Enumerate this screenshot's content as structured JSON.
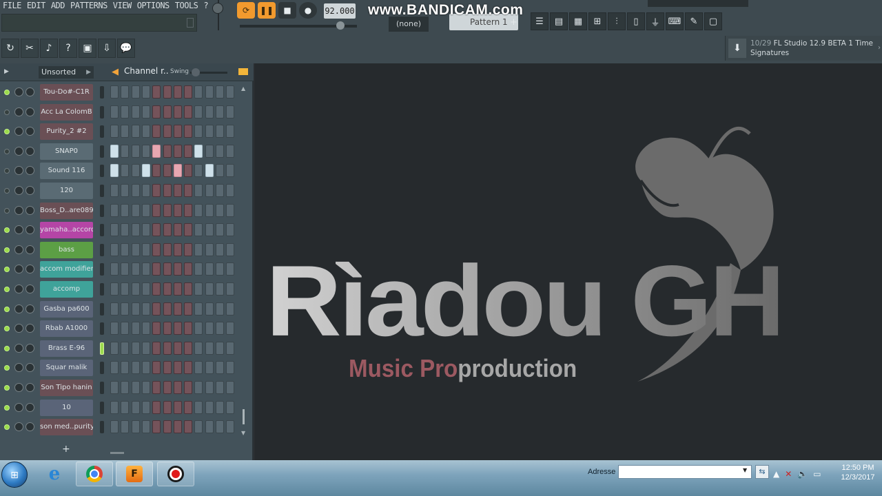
{
  "menu": {
    "items": [
      "FILE",
      "EDIT",
      "ADD",
      "PATTERNS",
      "VIEW",
      "OPTIONS",
      "TOOLS",
      "?"
    ]
  },
  "transport": {
    "tempo": "92.000",
    "pattern_selector": "(none)",
    "pattern_name": "Pattern 1"
  },
  "watermark": "www.BANDICAM.com",
  "news": {
    "count": "10/29",
    "text": "FL Studio 12.9 BETA 1 Time Signatures"
  },
  "rack": {
    "filter": "Unsorted",
    "title": "Channel r..",
    "swing_label": "Swing",
    "add_label": "+",
    "channels": [
      {
        "name": "Tou-Do#-C1R",
        "color": "#6a4f55",
        "led": true,
        "pattern": [
          0,
          0,
          0,
          0,
          0,
          0,
          0,
          0,
          0,
          0,
          0,
          0
        ],
        "selected": false
      },
      {
        "name": "Acc La ColomB",
        "color": "#6a4f55",
        "led": false,
        "pattern": [
          0,
          0,
          0,
          0,
          0,
          0,
          0,
          0,
          0,
          0,
          0,
          0
        ],
        "selected": false
      },
      {
        "name": "Purity_2 #2",
        "color": "#6a4f55",
        "led": true,
        "pattern": [
          0,
          0,
          0,
          0,
          0,
          0,
          0,
          0,
          0,
          0,
          0,
          0
        ],
        "selected": false
      },
      {
        "name": "SNAP0",
        "color": "#5a6b74",
        "led": false,
        "pattern": [
          1,
          0,
          0,
          0,
          2,
          0,
          0,
          0,
          1,
          0,
          0,
          0
        ],
        "selected": false
      },
      {
        "name": "Sound 116",
        "color": "#5a6b74",
        "led": false,
        "pattern": [
          1,
          0,
          0,
          1,
          0,
          0,
          2,
          0,
          0,
          1,
          0,
          0
        ],
        "selected": false
      },
      {
        "name": "120",
        "color": "#5a6b74",
        "led": false,
        "pattern": [
          0,
          0,
          0,
          0,
          0,
          0,
          0,
          0,
          0,
          0,
          0,
          0
        ],
        "selected": false
      },
      {
        "name": "Boss_D..are089",
        "color": "#6a4f55",
        "led": false,
        "pattern": [
          0,
          0,
          0,
          0,
          0,
          0,
          0,
          0,
          0,
          0,
          0,
          0
        ],
        "selected": false
      },
      {
        "name": "yamaha..accord",
        "color": "#b545a6",
        "led": true,
        "pattern": [
          0,
          0,
          0,
          0,
          0,
          0,
          0,
          0,
          0,
          0,
          0,
          0
        ],
        "selected": false
      },
      {
        "name": "bass",
        "color": "#5c9f45",
        "led": true,
        "pattern": [
          0,
          0,
          0,
          0,
          0,
          0,
          0,
          0,
          0,
          0,
          0,
          0
        ],
        "selected": false
      },
      {
        "name": "accom modifier",
        "color": "#3fa39a",
        "led": true,
        "pattern": [
          0,
          0,
          0,
          0,
          0,
          0,
          0,
          0,
          0,
          0,
          0,
          0
        ],
        "selected": false
      },
      {
        "name": "accomp",
        "color": "#3fa39a",
        "led": true,
        "pattern": [
          0,
          0,
          0,
          0,
          0,
          0,
          0,
          0,
          0,
          0,
          0,
          0
        ],
        "selected": false
      },
      {
        "name": "Gasba pa600",
        "color": "#5a6478",
        "led": true,
        "pattern": [
          0,
          0,
          0,
          0,
          0,
          0,
          0,
          0,
          0,
          0,
          0,
          0
        ],
        "selected": false
      },
      {
        "name": "Rbab A1000",
        "color": "#5a6478",
        "led": true,
        "pattern": [
          0,
          0,
          0,
          0,
          0,
          0,
          0,
          0,
          0,
          0,
          0,
          0
        ],
        "selected": false
      },
      {
        "name": "Brass E-96",
        "color": "#5a6478",
        "led": true,
        "pattern": [
          0,
          0,
          0,
          0,
          0,
          0,
          0,
          0,
          0,
          0,
          0,
          0
        ],
        "selected": true
      },
      {
        "name": "Squar malik",
        "color": "#5a6478",
        "led": true,
        "pattern": [
          0,
          0,
          0,
          0,
          0,
          0,
          0,
          0,
          0,
          0,
          0,
          0
        ],
        "selected": false
      },
      {
        "name": "Son Tipo hanin",
        "color": "#6a4f55",
        "led": true,
        "pattern": [
          0,
          0,
          0,
          0,
          0,
          0,
          0,
          0,
          0,
          0,
          0,
          0
        ],
        "selected": false
      },
      {
        "name": "10",
        "color": "#5a6478",
        "led": true,
        "pattern": [
          0,
          0,
          0,
          0,
          0,
          0,
          0,
          0,
          0,
          0,
          0,
          0
        ],
        "selected": false
      },
      {
        "name": "son med..purity",
        "color": "#6a4f55",
        "led": true,
        "pattern": [
          0,
          0,
          0,
          0,
          0,
          0,
          0,
          0,
          0,
          0,
          0,
          0
        ],
        "selected": false
      }
    ]
  },
  "canvas": {
    "brand": "Rìadou GH",
    "subtitle_a": "Music Pro",
    "subtitle_b": "production"
  },
  "taskbar": {
    "address_label": "Adresse",
    "address_value": "",
    "time": "12:50 PM",
    "date": "12/3/2017"
  }
}
